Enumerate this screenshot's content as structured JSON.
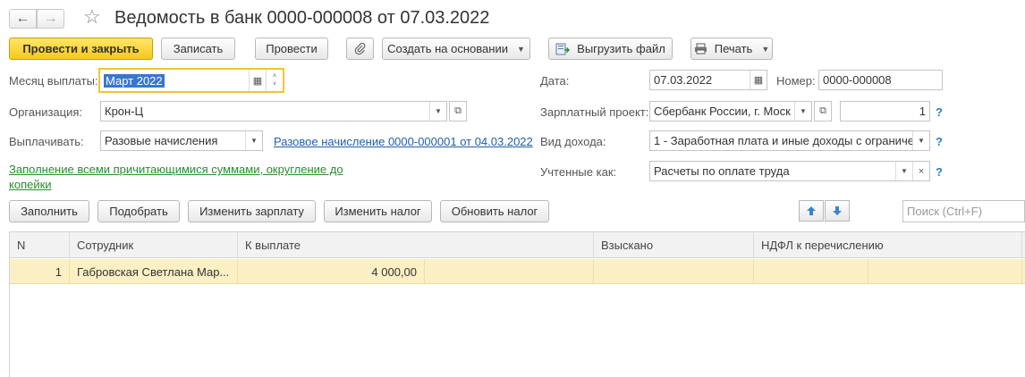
{
  "title": "Ведомость в банк 0000-000008 от 07.03.2022",
  "nav": {
    "back_icon": "←",
    "forward_icon": "→",
    "star_icon": "☆"
  },
  "toolbar": {
    "post_close": "Провести и закрыть",
    "save": "Записать",
    "post": "Провести",
    "create_based": "Создать на основании",
    "export_file": "Выгрузить файл",
    "print": "Печать"
  },
  "form": {
    "month_label": "Месяц выплаты:",
    "month_value": "Март 2022",
    "org_label": "Организация:",
    "org_value": "Крон-Ц",
    "pay_label": "Выплачивать:",
    "pay_value": "Разовые начисления",
    "accrual_link": "Разовое начисление 0000-000001 от 04.03.2022",
    "fill_link": "Заполнение всеми причитающимися суммами, округление до копейки",
    "date_label": "Дата:",
    "date_value": "07.03.2022",
    "number_label": "Номер:",
    "number_value": "0000-000008",
    "salary_project_label": "Зарплатный проект:",
    "salary_project_value": "Сбербанк России, г. Моск",
    "salary_project_count": "1",
    "income_type_label": "Вид дохода:",
    "income_type_value": "1 - Заработная плата и иные доходы с ограниче",
    "counted_as_label": "Учтенные как:",
    "counted_as_value": "Расчеты по оплате труда",
    "help": "?"
  },
  "actions": {
    "fill": "Заполнить",
    "select": "Подобрать",
    "change_salary": "Изменить зарплату",
    "change_tax": "Изменить налог",
    "update_tax": "Обновить налог",
    "search_placeholder": "Поиск (Ctrl+F)"
  },
  "table": {
    "columns": [
      "N",
      "Сотрудник",
      "К выплате",
      "Взыскано",
      "НДФЛ к перечислению"
    ],
    "rows": [
      {
        "n": "1",
        "employee": "Габровская Светлана Мар...",
        "to_pay": "4 000,00",
        "withheld": "",
        "ndfl": ""
      }
    ]
  },
  "colors": {
    "primary": "#f5c81a",
    "link": "#1f5fa8",
    "green_link": "#2a8c2a",
    "selected_row": "#fbf0c4"
  }
}
